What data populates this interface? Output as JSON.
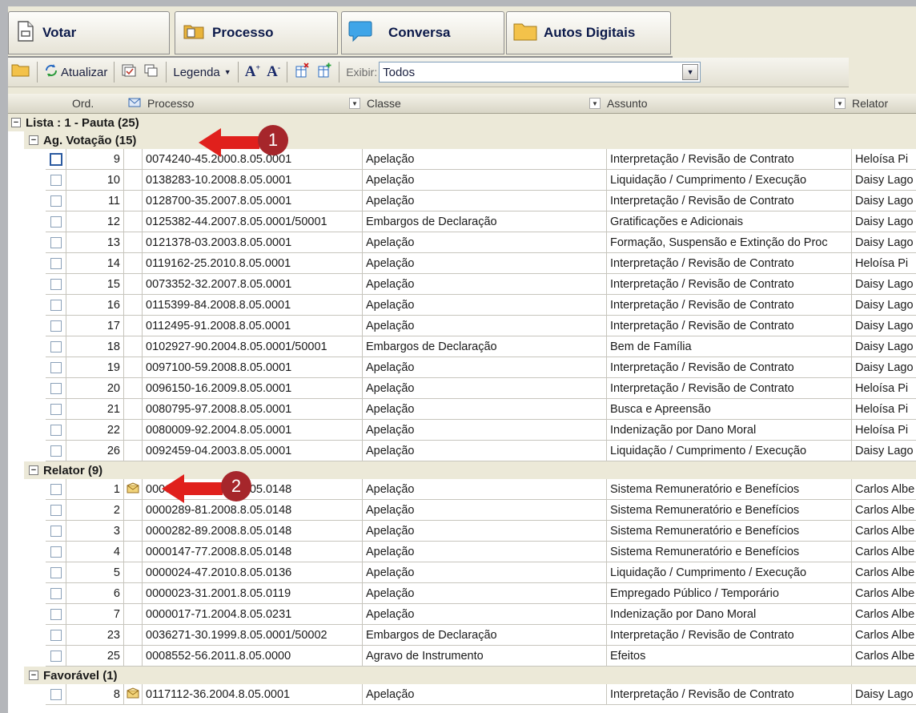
{
  "tabs": [
    {
      "label": "Votar",
      "icon": "document-icon"
    },
    {
      "label": "Processo",
      "icon": "folder-doc-icon"
    },
    {
      "label": "Conversa",
      "icon": "chat-bubble-icon"
    },
    {
      "label": "Autos Digitais",
      "icon": "folder-icon"
    }
  ],
  "toolbar": {
    "refresh_label": "Atualizar",
    "legend_label": "Legenda",
    "exibir_label": "Exibir:",
    "exibir_value": "Todos"
  },
  "columns": {
    "ord": "Ord.",
    "processo": "Processo",
    "classe": "Classe",
    "assunto": "Assunto",
    "relator": "Relator"
  },
  "list_title": "Lista : 1 - Pauta (25)",
  "groups": [
    {
      "title": "Ag. Votação (15)",
      "rows": [
        {
          "ord": "9",
          "processo": "0074240-45.2000.8.05.0001",
          "classe": "Apelação",
          "assunto": "Interpretação / Revisão de Contrato",
          "relator": "Heloísa Pi"
        },
        {
          "ord": "10",
          "processo": "0138283-10.2008.8.05.0001",
          "classe": "Apelação",
          "assunto": "Liquidação / Cumprimento / Execução",
          "relator": "Daisy Lago"
        },
        {
          "ord": "11",
          "processo": "0128700-35.2007.8.05.0001",
          "classe": "Apelação",
          "assunto": "Interpretação / Revisão de Contrato",
          "relator": "Daisy Lago"
        },
        {
          "ord": "12",
          "processo": "0125382-44.2007.8.05.0001/50001",
          "classe": "Embargos de Declaração",
          "assunto": "Gratificações e Adicionais",
          "relator": "Daisy Lago"
        },
        {
          "ord": "13",
          "processo": "0121378-03.2003.8.05.0001",
          "classe": "Apelação",
          "assunto": "Formação, Suspensão e Extinção do Proc",
          "relator": "Daisy Lago"
        },
        {
          "ord": "14",
          "processo": "0119162-25.2010.8.05.0001",
          "classe": "Apelação",
          "assunto": "Interpretação / Revisão de Contrato",
          "relator": "Heloísa Pi"
        },
        {
          "ord": "15",
          "processo": "0073352-32.2007.8.05.0001",
          "classe": "Apelação",
          "assunto": "Interpretação / Revisão de Contrato",
          "relator": "Daisy Lago"
        },
        {
          "ord": "16",
          "processo": "0115399-84.2008.8.05.0001",
          "classe": "Apelação",
          "assunto": "Interpretação / Revisão de Contrato",
          "relator": "Daisy Lago"
        },
        {
          "ord": "17",
          "processo": "0112495-91.2008.8.05.0001",
          "classe": "Apelação",
          "assunto": "Interpretação / Revisão de Contrato",
          "relator": "Daisy Lago"
        },
        {
          "ord": "18",
          "processo": "0102927-90.2004.8.05.0001/50001",
          "classe": "Embargos de Declaração",
          "assunto": "Bem de Família",
          "relator": "Daisy Lago"
        },
        {
          "ord": "19",
          "processo": "0097100-59.2008.8.05.0001",
          "classe": "Apelação",
          "assunto": "Interpretação / Revisão de Contrato",
          "relator": "Daisy Lago"
        },
        {
          "ord": "20",
          "processo": "0096150-16.2009.8.05.0001",
          "classe": "Apelação",
          "assunto": "Interpretação / Revisão de Contrato",
          "relator": "Heloísa Pi"
        },
        {
          "ord": "21",
          "processo": "0080795-97.2008.8.05.0001",
          "classe": "Apelação",
          "assunto": "Busca e Apreensão",
          "relator": "Heloísa Pi"
        },
        {
          "ord": "22",
          "processo": "0080009-92.2004.8.05.0001",
          "classe": "Apelação",
          "assunto": "Indenização por Dano Moral",
          "relator": "Heloísa Pi"
        },
        {
          "ord": "26",
          "processo": "0092459-04.2003.8.05.0001",
          "classe": "Apelação",
          "assunto": "Liquidação / Cumprimento / Execução",
          "relator": "Daisy Lago"
        }
      ]
    },
    {
      "title": "Relator (9)",
      "rows": [
        {
          "ord": "1",
          "processo": "0000195-88.2008.8.05.0148",
          "classe": "Apelação",
          "assunto": "Sistema Remuneratório e Benefícios",
          "relator": "Carlos Albe",
          "icon": "envelope-icon"
        },
        {
          "ord": "2",
          "processo": "0000289-81.2008.8.05.0148",
          "classe": "Apelação",
          "assunto": "Sistema Remuneratório e Benefícios",
          "relator": "Carlos Albe"
        },
        {
          "ord": "3",
          "processo": "0000282-89.2008.8.05.0148",
          "classe": "Apelação",
          "assunto": "Sistema Remuneratório e Benefícios",
          "relator": "Carlos Albe"
        },
        {
          "ord": "4",
          "processo": "0000147-77.2008.8.05.0148",
          "classe": "Apelação",
          "assunto": "Sistema Remuneratório e Benefícios",
          "relator": "Carlos Albe"
        },
        {
          "ord": "5",
          "processo": "0000024-47.2010.8.05.0136",
          "classe": "Apelação",
          "assunto": "Liquidação / Cumprimento / Execução",
          "relator": "Carlos Albe"
        },
        {
          "ord": "6",
          "processo": "0000023-31.2001.8.05.0119",
          "classe": "Apelação",
          "assunto": "Empregado Público / Temporário",
          "relator": "Carlos Albe"
        },
        {
          "ord": "7",
          "processo": "0000017-71.2004.8.05.0231",
          "classe": "Apelação",
          "assunto": "Indenização por Dano Moral",
          "relator": "Carlos Albe"
        },
        {
          "ord": "23",
          "processo": "0036271-30.1999.8.05.0001/50002",
          "classe": "Embargos de Declaração",
          "assunto": "Interpretação / Revisão de Contrato",
          "relator": "Carlos Albe"
        },
        {
          "ord": "25",
          "processo": "0008552-56.2011.8.05.0000",
          "classe": "Agravo de Instrumento",
          "assunto": "Efeitos",
          "relator": "Carlos Albe"
        }
      ]
    },
    {
      "title": "Favorável (1)",
      "rows": [
        {
          "ord": "8",
          "processo": "0117112-36.2004.8.05.0001",
          "classe": "Apelação",
          "assunto": "Interpretação / Revisão de Contrato",
          "relator": "Daisy Lago",
          "icon": "envelope-icon"
        }
      ]
    }
  ],
  "annotations": [
    {
      "label": "1",
      "color": "#a6262b",
      "arrow_color": "#e0201c"
    },
    {
      "label": "2",
      "color": "#a6262b",
      "arrow_color": "#e0201c"
    }
  ]
}
